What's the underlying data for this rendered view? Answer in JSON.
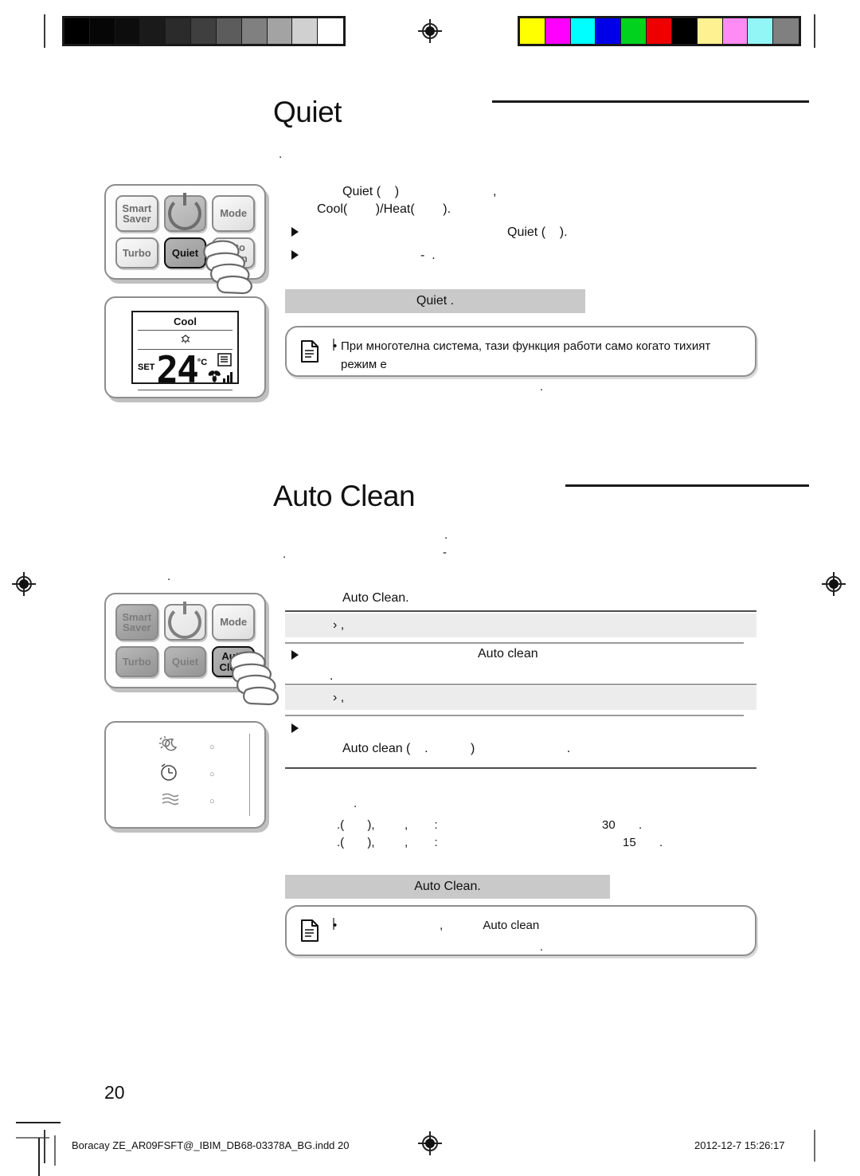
{
  "document": {
    "page_number": "20",
    "footer_file": "Boracay ZE_AR09FSFT@_IBIM_DB68-03378A_BG.indd   20",
    "footer_timestamp": "2012-12-7   15:26:17"
  },
  "calibration": {
    "grayscale_swatches": [
      "#000000",
      "#060606",
      "#0d0d0d",
      "#1a1a1a",
      "#2b2b2b",
      "#3f3f3f",
      "#5c5c5c",
      "#808080",
      "#a3a3a3",
      "#d0d0d0",
      "#ffffff"
    ],
    "color_swatches": [
      "#ffff00",
      "#ff00ff",
      "#00ffff",
      "#0000e8",
      "#00d21e",
      "#ee0000",
      "#000000",
      "#fdf191",
      "#ff8cf4",
      "#93f6f6",
      "#808080"
    ]
  },
  "quiet_section": {
    "title": "Quiet",
    "intro_dot": ".",
    "line1": "Quiet (    )",
    "line1_tail": ",",
    "line2": "Cool(        )/Heat(        ).",
    "bullet1": "Quiet (    ).",
    "bullet2": "-  .",
    "caption": "Quiet .",
    "note": "При многотелна система, тази функция работи само когато тихият режим е",
    "note_line2": "."
  },
  "autoclean_section": {
    "title": "Auto Clean",
    "lead_dot1": ".",
    "lead_dot2": ".",
    "lead_dash": "-",
    "subhead": "Auto Clean.",
    "band1": "›  ,",
    "row1_text": "Auto clean",
    "row1_tail": ".",
    "band2": "›  ,",
    "row2_text": "Auto clean (    .            )                          .",
    "timing_dot": ".",
    "timing_line1_prefix": ".(       ),         ,        :",
    "timing_line1_value": "30",
    "timing_line1_suffix": ".",
    "timing_line2_prefix": ".(       ),         ,        :",
    "timing_line2_value": "15",
    "timing_line2_suffix": ".",
    "caption": "Auto Clean.",
    "note": "Auto clean",
    "note_prefix": ",",
    "note_line2": "."
  },
  "remote_top": {
    "buttons": [
      {
        "label": "Smart\nSaver",
        "state": "normal"
      },
      {
        "label": "power",
        "state": "power-dark"
      },
      {
        "label": "Mode",
        "state": "normal"
      },
      {
        "label": "Turbo",
        "state": "normal"
      },
      {
        "label": "Quiet",
        "state": "active"
      },
      {
        "label": "Auto\nClean",
        "state": "normal"
      }
    ]
  },
  "remote_bottom": {
    "buttons": [
      {
        "label": "Smart\nSaver",
        "state": "dim"
      },
      {
        "label": "power",
        "state": "power-light"
      },
      {
        "label": "Mode",
        "state": "normal"
      },
      {
        "label": "Turbo",
        "state": "dim"
      },
      {
        "label": "Quiet",
        "state": "dim"
      },
      {
        "label": "Auto\nClean",
        "state": "active"
      }
    ]
  },
  "lcd_display": {
    "mode": "Cool",
    "set_label": "SET",
    "temperature": "24",
    "unit": "°C"
  },
  "indicator_panel": {
    "rows": [
      "sun-moon-icon",
      "timer-icon",
      "airflow-icon"
    ],
    "led": "○"
  }
}
